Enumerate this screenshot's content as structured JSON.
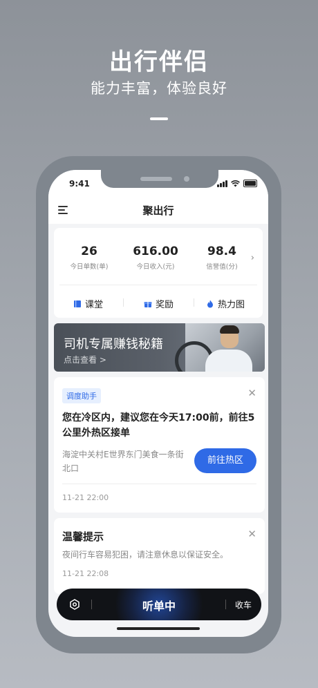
{
  "hero": {
    "title": "出行伴侣",
    "subtitle": "能力丰富，体验良好"
  },
  "status_bar": {
    "time": "9:41"
  },
  "navbar": {
    "title": "聚出行",
    "menu_icon": "menu-icon"
  },
  "stats": [
    {
      "value": "26",
      "label": "今日单数(单)"
    },
    {
      "value": "616.00",
      "label": "今日收入(元)"
    },
    {
      "value": "98.4",
      "label": "信誉值(分)"
    }
  ],
  "quick_links": [
    {
      "label": "课堂",
      "icon": "book-icon",
      "color": "#2f6ae6"
    },
    {
      "label": "奖励",
      "icon": "gift-icon",
      "color": "#2f6ae6"
    },
    {
      "label": "热力图",
      "icon": "flame-icon",
      "color": "#2f6ae6"
    }
  ],
  "banner": {
    "title": "司机专属赚钱秘籍",
    "subtitle": "点击查看 >"
  },
  "dispatch": {
    "tag": "调度助手",
    "message": "您在冷区内，建议您在今天17:00前，前往5公里外热区接单",
    "location": "海淀中关村E世界东门美食一条街北口",
    "button": "前往热区",
    "time": "11-21 22:00"
  },
  "tip": {
    "title": "温馨提示",
    "body": "夜间行车容易犯困，请注意休息以保证安全。",
    "time": "11-21 22:08"
  },
  "bottom_bar": {
    "main": "听单中",
    "right": "收车",
    "left_icon": "settings-icon"
  },
  "colors": {
    "accent": "#2f6ae6",
    "bottom_bar": "#111317"
  }
}
